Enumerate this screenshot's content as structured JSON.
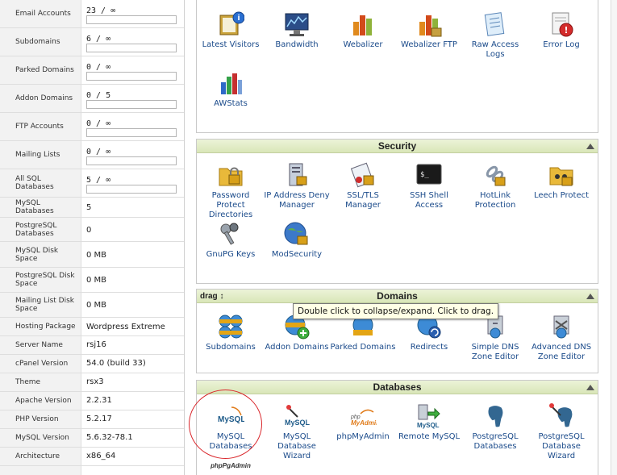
{
  "stats": [
    {
      "label": "Email Accounts",
      "value": "23 / ∞",
      "bar": true
    },
    {
      "label": "Subdomains",
      "value": "6 / ∞",
      "bar": true
    },
    {
      "label": "Parked Domains",
      "value": "0 / ∞",
      "bar": true
    },
    {
      "label": "Addon Domains",
      "value": "0 / 5",
      "bar": true
    },
    {
      "label": "FTP Accounts",
      "value": "0 / ∞",
      "bar": true
    },
    {
      "label": "Mailing Lists",
      "value": "0 / ∞",
      "bar": true
    },
    {
      "label": "All SQL Databases",
      "value": "5 / ∞",
      "bar": true
    },
    {
      "label": "MySQL Databases",
      "value": "5"
    },
    {
      "label": "PostgreSQL Databases",
      "value": "0"
    },
    {
      "label": "MySQL Disk Space",
      "value": "0 MB"
    },
    {
      "label": "PostgreSQL Disk Space",
      "value": "0 MB"
    },
    {
      "label": "Mailing List Disk Space",
      "value": "0 MB"
    },
    {
      "label": "Hosting Package",
      "value": "Wordpress Extreme"
    },
    {
      "label": "Server Name",
      "value": "rsj16"
    },
    {
      "label": "cPanel Version",
      "value": "54.0 (build 33)"
    },
    {
      "label": "Theme",
      "value": "rsx3"
    },
    {
      "label": "Apache Version",
      "value": "2.2.31"
    },
    {
      "label": "PHP Version",
      "value": "5.2.17"
    },
    {
      "label": "MySQL Version",
      "value": "5.6.32-78.1"
    },
    {
      "label": "Architecture",
      "value": "x86_64"
    }
  ],
  "logs": {
    "items": [
      {
        "label": "Latest Visitors",
        "icon": "latest-visitors-icon"
      },
      {
        "label": "Bandwidth",
        "icon": "bandwidth-icon"
      },
      {
        "label": "Webalizer",
        "icon": "webalizer-icon"
      },
      {
        "label": "Webalizer FTP",
        "icon": "webalizer-ftp-icon"
      },
      {
        "label": "Raw Access Logs",
        "icon": "raw-access-logs-icon"
      },
      {
        "label": "Error Log",
        "icon": "error-log-icon"
      },
      {
        "label": "AWStats",
        "icon": "awstats-icon"
      }
    ]
  },
  "security": {
    "title": "Security",
    "items": [
      {
        "label": "Password Protect Directories",
        "icon": "password-protect-icon"
      },
      {
        "label": "IP Address Deny Manager",
        "icon": "ip-deny-icon"
      },
      {
        "label": "SSL/TLS Manager",
        "icon": "ssl-tls-icon"
      },
      {
        "label": "SSH Shell Access",
        "icon": "ssh-shell-icon"
      },
      {
        "label": "HotLink Protection",
        "icon": "hotlink-icon"
      },
      {
        "label": "Leech Protect",
        "icon": "leech-protect-icon"
      },
      {
        "label": "GnuPG Keys",
        "icon": "gnupg-keys-icon"
      },
      {
        "label": "ModSecurity",
        "icon": "modsecurity-icon"
      }
    ]
  },
  "domains": {
    "title": "Domains",
    "drag_label": "drag",
    "items": [
      {
        "label": "Subdomains",
        "icon": "subdomains-icon"
      },
      {
        "label": "Addon Domains",
        "icon": "addon-domains-icon"
      },
      {
        "label": "Parked Domains",
        "icon": "parked-domains-icon"
      },
      {
        "label": "Redirects",
        "icon": "redirects-icon"
      },
      {
        "label": "Simple DNS Zone Editor",
        "icon": "simple-dns-icon"
      },
      {
        "label": "Advanced DNS Zone Editor",
        "icon": "advanced-dns-icon"
      }
    ]
  },
  "databases": {
    "title": "Databases",
    "items": [
      {
        "label": "MySQL Databases",
        "icon": "mysql-databases-icon"
      },
      {
        "label": "MySQL Database Wizard",
        "icon": "mysql-wizard-icon"
      },
      {
        "label": "phpMyAdmin",
        "icon": "phpmyadmin-icon"
      },
      {
        "label": "Remote MySQL",
        "icon": "remote-mysql-icon"
      },
      {
        "label": "PostgreSQL Databases",
        "icon": "postgresql-databases-icon"
      },
      {
        "label": "PostgreSQL Database Wizard",
        "icon": "postgresql-wizard-icon"
      }
    ],
    "partial_icon_text": "phpPgAdmin"
  },
  "tooltip": "Double click to collapse/expand. Click to drag.",
  "colors": {
    "panel_header": "#d9e6b8",
    "link": "#1a4a8a",
    "highlight": "#d9262b"
  }
}
